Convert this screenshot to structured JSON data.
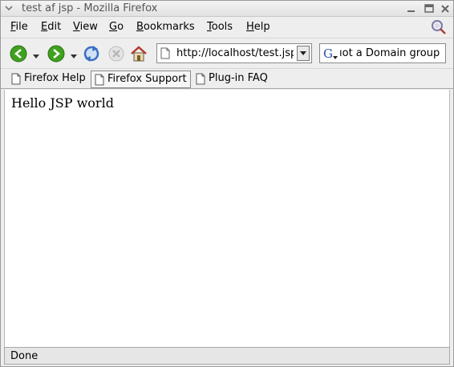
{
  "window": {
    "title": "test af jsp - Mozilla Firefox"
  },
  "menubar": {
    "items": [
      {
        "label": "File",
        "accesskey": "F",
        "rest": "ile"
      },
      {
        "label": "Edit",
        "accesskey": "E",
        "rest": "dit"
      },
      {
        "label": "View",
        "accesskey": "V",
        "rest": "iew"
      },
      {
        "label": "Go",
        "accesskey": "G",
        "rest": "o"
      },
      {
        "label": "Bookmarks",
        "accesskey": "B",
        "rest": "ookmarks"
      },
      {
        "label": "Tools",
        "accesskey": "T",
        "rest": "ools"
      },
      {
        "label": "Help",
        "accesskey": "H",
        "rest": "elp"
      }
    ]
  },
  "navigation": {
    "url": "http://localhost/test.jsp",
    "search_value": "not a Domain group",
    "search_visible_text": "ıot a Domain group"
  },
  "bookmarks": {
    "items": [
      {
        "label": "Firefox Help",
        "active": false
      },
      {
        "label": "Firefox Support",
        "active": true
      },
      {
        "label": "Plug-in FAQ",
        "active": false
      }
    ]
  },
  "content": {
    "text": "Hello JSP world"
  },
  "status": {
    "text": "Done"
  },
  "colors": {
    "chrome_bg": "#eeeeee",
    "back_forward_green": "#3fa11e",
    "reload_blue": "#3a6fc4",
    "home_red": "#b03a2e"
  },
  "icons": [
    "window-menu-icon",
    "minimize-icon",
    "maximize-icon",
    "close-icon",
    "throbber-icon",
    "back-icon",
    "forward-icon",
    "reload-icon",
    "stop-icon",
    "home-icon",
    "page-icon",
    "search-engine-icon",
    "dropdown-arrow-icon"
  ]
}
